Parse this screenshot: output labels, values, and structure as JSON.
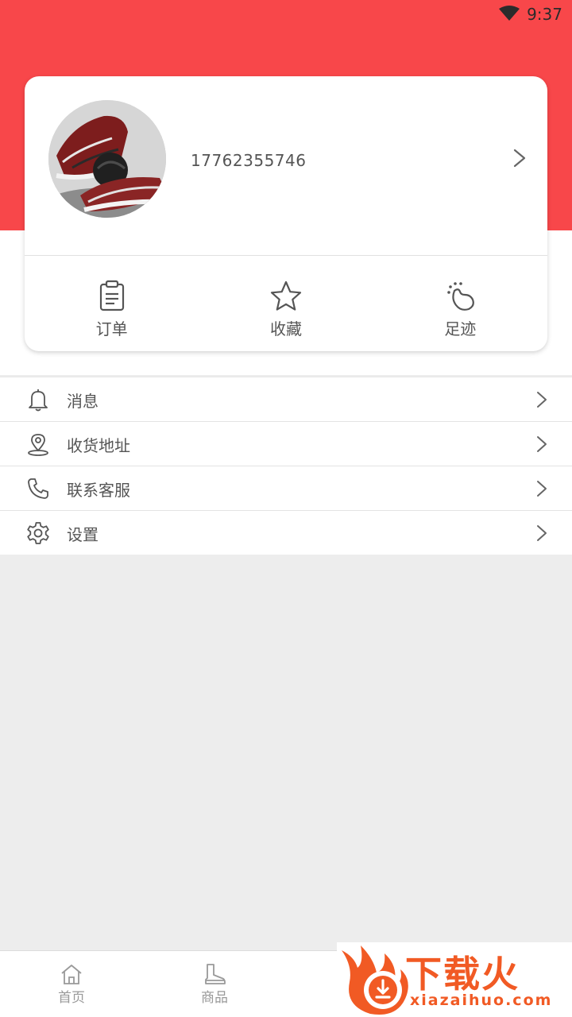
{
  "status_bar": {
    "time": "9:37"
  },
  "profile": {
    "phone": "17762355746",
    "avatar_icon": "sneaker-photo"
  },
  "quick_actions": [
    {
      "label": "订单",
      "icon": "clipboard-icon"
    },
    {
      "label": "收藏",
      "icon": "star-icon"
    },
    {
      "label": "足迹",
      "icon": "footprint-icon"
    }
  ],
  "menu": [
    {
      "label": "消息",
      "icon": "bell-icon"
    },
    {
      "label": "收货地址",
      "icon": "location-pin-icon"
    },
    {
      "label": "联系客服",
      "icon": "phone-icon"
    },
    {
      "label": "设置",
      "icon": "gear-icon"
    }
  ],
  "tabbar": {
    "tabs": [
      {
        "label": "首页",
        "icon": "home-icon"
      },
      {
        "label": "商品",
        "icon": "boot-icon"
      }
    ]
  },
  "watermark": {
    "main": "下载火",
    "sub": "xiazaihuo.com"
  },
  "colors": {
    "brand_red": "#f8474a",
    "watermark_orange": "#f15a24",
    "background": "#ededed"
  }
}
